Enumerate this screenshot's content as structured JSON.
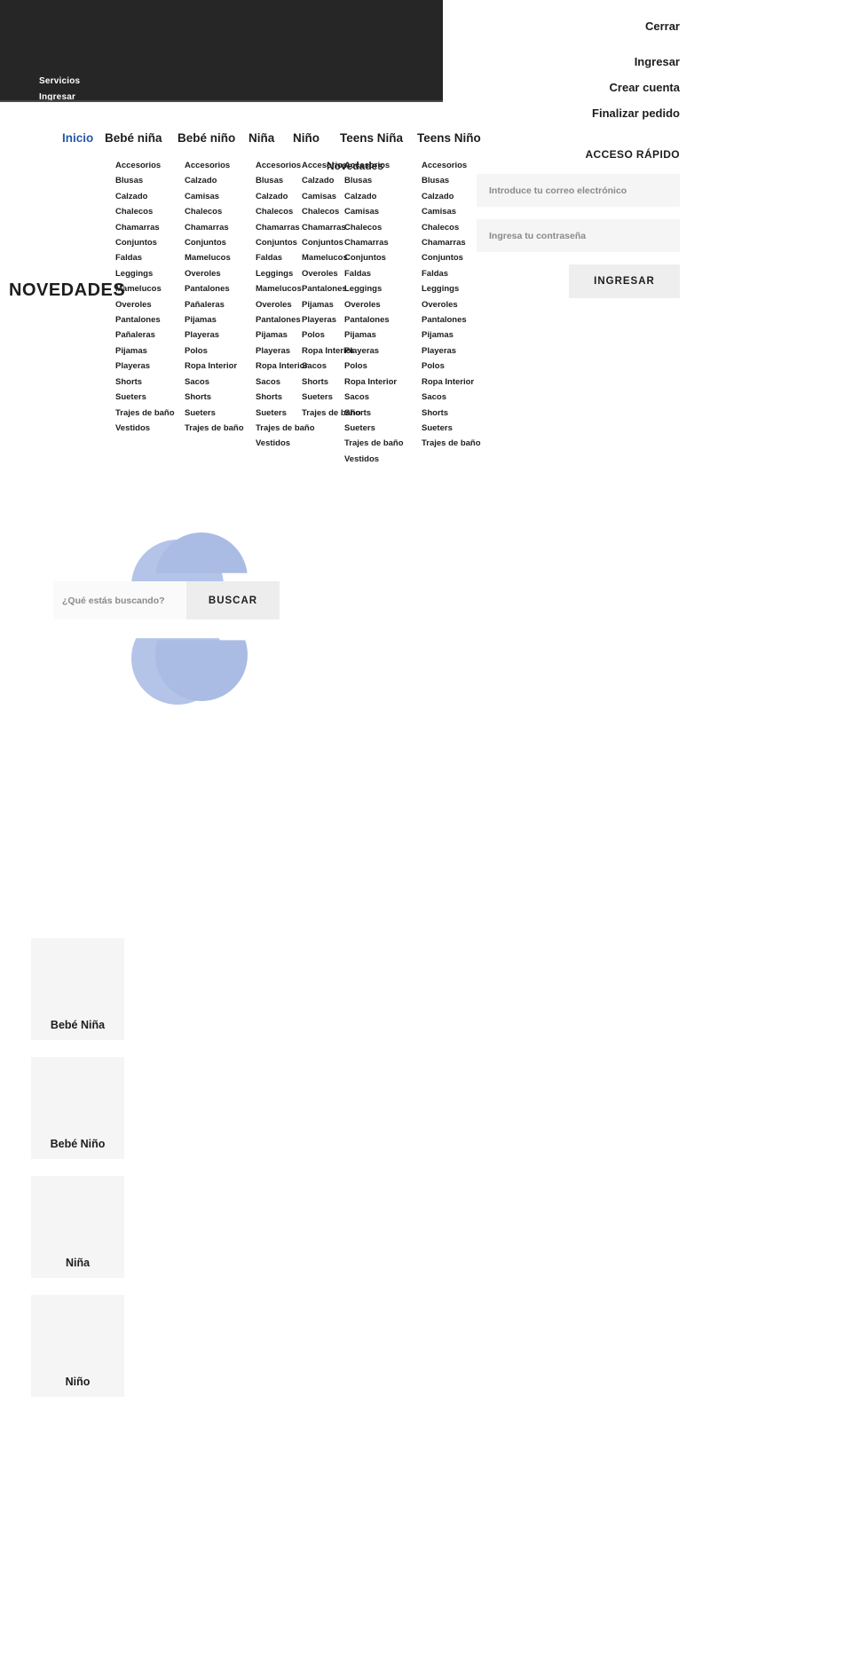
{
  "topbar": {
    "links": [
      {
        "label": "Servicios"
      },
      {
        "label": "Ingresar"
      }
    ]
  },
  "account_panel": {
    "close_label": "Cerrar",
    "links": [
      {
        "label": "Ingresar"
      },
      {
        "label": "Crear cuenta"
      },
      {
        "label": "Finalizar pedido"
      }
    ],
    "quick_access_title": "ACCESO RÁPIDO",
    "email_placeholder": "Introduce tu correo electrónico",
    "email_value": "",
    "password_placeholder": "Ingresa tu contraseña",
    "password_value": "",
    "submit_label": "INGRESAR"
  },
  "nav": {
    "active_color": "#2659a8",
    "top_items": [
      {
        "label": "Inicio",
        "active": true
      },
      {
        "label": "Bebé niña",
        "active": false
      },
      {
        "label": "Bebé niño",
        "active": false
      },
      {
        "label": "Niña",
        "active": false
      },
      {
        "label": "Niño",
        "active": false
      },
      {
        "label": "Teens Niña",
        "active": false
      },
      {
        "label": "Teens Niño",
        "active": false
      }
    ],
    "ghost_label": "Novedades",
    "columns": [
      {
        "parent": "Bebé niña",
        "items": [
          "Accesorios",
          "Blusas",
          "Calzado",
          "Chalecos",
          "Chamarras",
          "Conjuntos",
          "Faldas",
          "Leggings",
          "Mamelucos",
          "Overoles",
          "Pantalones",
          "Pañaleras",
          "Pijamas",
          "Playeras",
          "Shorts",
          "Sueters",
          "Trajes de baño",
          "Vestidos"
        ]
      },
      {
        "parent": "Bebé niño",
        "items": [
          "Accesorios",
          "Calzado",
          "Camisas",
          "Chalecos",
          "Chamarras",
          "Conjuntos",
          "Mamelucos",
          "Overoles",
          "Pantalones",
          "Pañaleras",
          "Pijamas",
          "Playeras",
          "Polos",
          "Ropa Interior",
          "Sacos",
          "Shorts",
          "Sueters",
          "Trajes de baño"
        ]
      },
      {
        "parent": "Niña",
        "items": [
          "Accesorios",
          "Blusas",
          "Calzado",
          "Chalecos",
          "Chamarras",
          "Conjuntos",
          "Faldas",
          "Leggings",
          "Mamelucos",
          "Overoles",
          "Pantalones",
          "Pijamas",
          "Playeras",
          "Ropa Interior",
          "Sacos",
          "Shorts",
          "Sueters",
          "Trajes de baño",
          "Vestidos"
        ]
      },
      {
        "parent": "Niño",
        "items": [
          "Accesorios",
          "Calzado",
          "Camisas",
          "Chalecos",
          "Chamarras",
          "Conjuntos",
          "Mamelucos",
          "Overoles",
          "Pantalones",
          "Pijamas",
          "Playeras",
          "Polos",
          "Ropa Interior",
          "Sacos",
          "Shorts",
          "Sueters",
          "Trajes de baño"
        ]
      },
      {
        "parent": "Teens Niña",
        "items": [
          "Accesorios",
          "Blusas",
          "Calzado",
          "Camisas",
          "Chalecos",
          "Chamarras",
          "Conjuntos",
          "Faldas",
          "Leggings",
          "Overoles",
          "Pantalones",
          "Pijamas",
          "Playeras",
          "Polos",
          "Ropa Interior",
          "Sacos",
          "Shorts",
          "Sueters",
          "Trajes de baño",
          "Vestidos"
        ]
      },
      {
        "parent": "Teens Niño",
        "items": [
          "Accesorios",
          "Blusas",
          "Calzado",
          "Camisas",
          "Chalecos",
          "Chamarras",
          "Conjuntos",
          "Faldas",
          "Leggings",
          "Overoles",
          "Pantalones",
          "Pijamas",
          "Playeras",
          "Polos",
          "Ropa Interior",
          "Sacos",
          "Shorts",
          "Sueters",
          "Trajes de baño"
        ]
      }
    ]
  },
  "hero": {
    "section_title": "NOVEDADES",
    "decoration_color": "#b3c4e8"
  },
  "search": {
    "placeholder": "¿Qué estás buscando?",
    "value": "",
    "button_label": "BUSCAR"
  },
  "categories": [
    {
      "label": "Bebé Niña"
    },
    {
      "label": "Bebé Niño"
    },
    {
      "label": "Niña"
    },
    {
      "label": "Niño"
    }
  ]
}
